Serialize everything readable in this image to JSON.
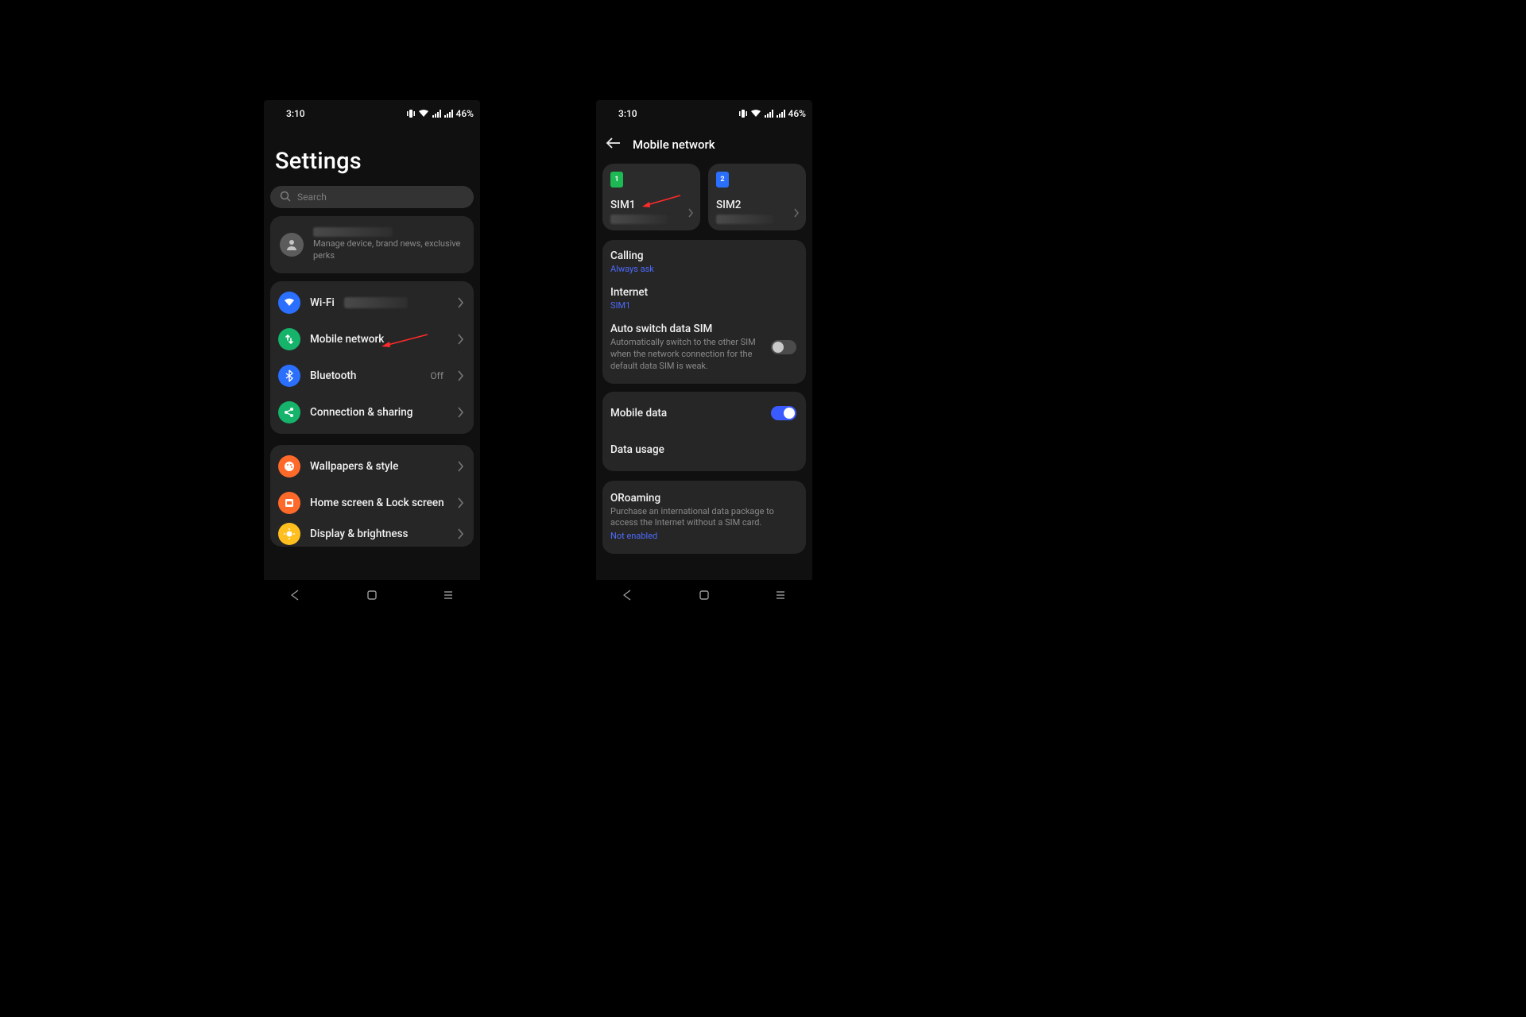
{
  "status": {
    "time": "3:10",
    "battery": "46%"
  },
  "left": {
    "title": "Settings",
    "search_placeholder": "Search",
    "profile_sub": "Manage device, brand news, exclusive perks",
    "items": {
      "wifi": {
        "label": "Wi-Fi"
      },
      "mobile": {
        "label": "Mobile network"
      },
      "bluetooth": {
        "label": "Bluetooth",
        "status": "Off"
      },
      "connshare": {
        "label": "Connection & sharing"
      },
      "wallpaper": {
        "label": "Wallpapers & style"
      },
      "homelock": {
        "label": "Home screen & Lock screen"
      },
      "display": {
        "label": "Display & brightness"
      }
    }
  },
  "right": {
    "title": "Mobile network",
    "sim1": {
      "name": "SIM1",
      "badge": "1"
    },
    "sim2": {
      "name": "SIM2",
      "badge": "2"
    },
    "calling": {
      "label": "Calling",
      "value": "Always ask"
    },
    "internet": {
      "label": "Internet",
      "value": "SIM1"
    },
    "autoswitch": {
      "label": "Auto switch data SIM",
      "desc": "Automatically switch to the other SIM when the network connection for the default data SIM is weak."
    },
    "mobiledata": {
      "label": "Mobile data"
    },
    "datausage": {
      "label": "Data usage"
    },
    "oroaming": {
      "label": "ORoaming",
      "desc": "Purchase an international data package to access the Internet without a SIM card.",
      "status": "Not enabled"
    }
  }
}
